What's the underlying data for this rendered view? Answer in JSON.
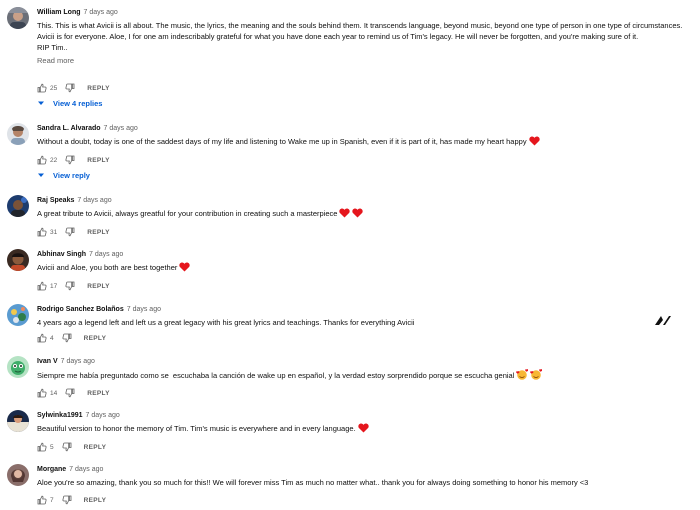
{
  "comments": [
    {
      "author": "William Long",
      "time": "7 days ago",
      "text": "This. This is what Avicii is all about. The music, the lyrics, the meaning and the souls behind them. It transcends language, beyond music, beyond one type of person in one type of circumstances. Avicii is for everyone. Aloe, I for one am indescribably grateful for what you have done each year to remind us of Tim's legacy. He will never be forgotten, and you're making sure of it.\nRIP Tim..",
      "read_more": "Read more",
      "likes": "25",
      "reply_label": "REPLY",
      "replies_label": "View 4 replies"
    },
    {
      "author": "Sandra L. Alvarado",
      "time": "7 days ago",
      "text": "Without a doubt, today is one of the saddest days of my life and listening to Wake me up in Spanish, even if it is part of it, has made my heart happy",
      "likes": "22",
      "reply_label": "REPLY",
      "replies_label": "View reply"
    },
    {
      "author": "Raj Speaks",
      "time": "7 days ago",
      "text": "A great tribute to Avicii, always greatful for your contribution in creating such a masterpiece",
      "likes": "31",
      "reply_label": "REPLY"
    },
    {
      "author": "Abhinav Singh",
      "time": "7 days ago",
      "text": "Avicii and Aloe, you both are best together",
      "likes": "17",
      "reply_label": "REPLY"
    },
    {
      "author": "Rodrigo Sanchez Bolaños",
      "time": "7 days ago",
      "text": "4 years ago a legend left and left us a great legacy with his great lyrics and teachings. Thanks for everything Avicii",
      "likes": "4",
      "reply_label": "REPLY"
    },
    {
      "author": "Ivan V",
      "time": "7 days ago",
      "text": "Siempre me había preguntado como se  escuchaba la canción de wake up en español, y la verdad estoy sorprendido porque se escucha genial",
      "likes": "14",
      "reply_label": "REPLY"
    },
    {
      "author": "Sylwinka1991",
      "time": "7 days ago",
      "text": "Beautiful version to honor the memory of Tim. Tim's music is everywhere and in every language.",
      "likes": "5",
      "reply_label": "REPLY"
    },
    {
      "author": "Morgane",
      "time": "7 days ago",
      "text": "Aloe you're so amazing, thank you so much for this!! We will forever miss Tim as much no matter what.. thank you for always doing something to honor his memory <3",
      "likes": "7",
      "reply_label": "REPLY"
    }
  ],
  "colors": {
    "link": "#065fd4",
    "meta": "#606060",
    "heart": "#e5161d"
  },
  "icons": {
    "like": "thumbs-up-icon",
    "dislike": "thumbs-down-icon",
    "expand": "chevron-down-icon",
    "heart": "red-heart-emoji",
    "hearts_face": "smiling-face-with-hearts-emoji",
    "logo": "avicii-logo-icon"
  }
}
